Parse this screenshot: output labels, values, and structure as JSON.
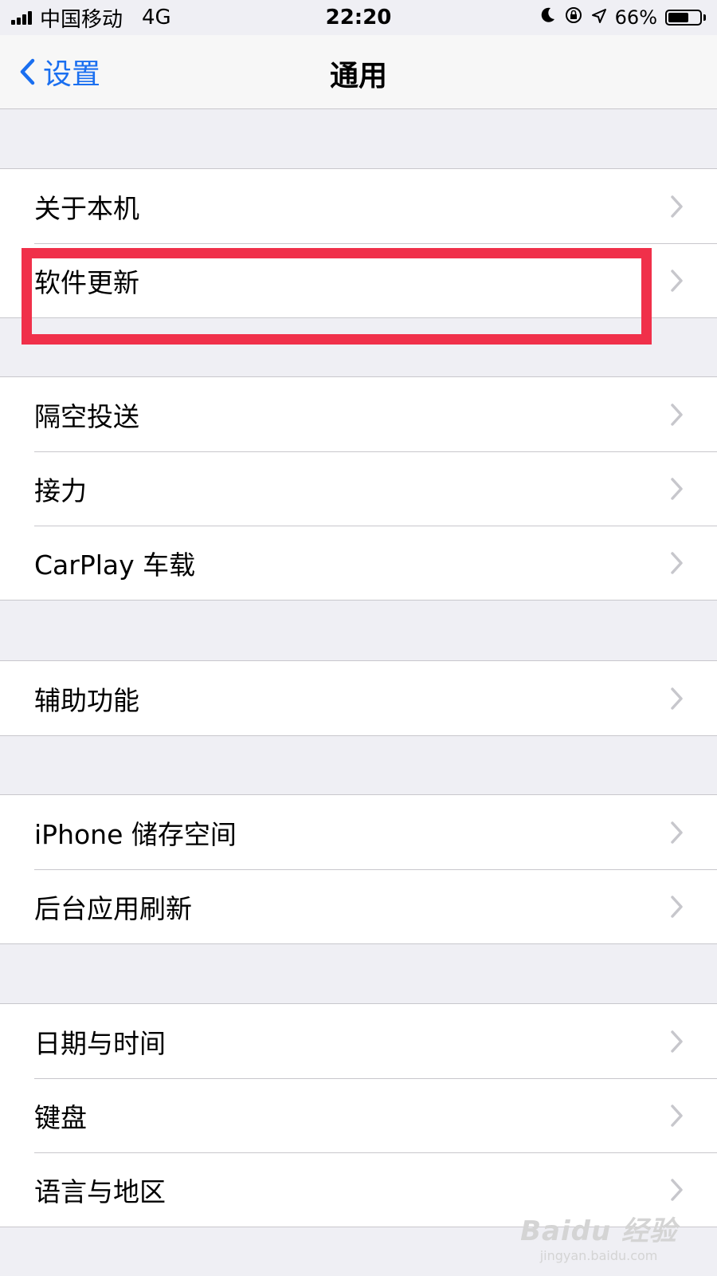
{
  "status_bar": {
    "carrier": "中国移动",
    "network": "4G",
    "time": "22:20",
    "battery_percent_text": "66%",
    "battery_level": 0.66,
    "icons": [
      "signal-icon",
      "moon-icon",
      "rotation-lock-icon",
      "location-icon",
      "battery-icon"
    ]
  },
  "nav": {
    "back_label": "设置",
    "title": "通用"
  },
  "groups": [
    {
      "items": [
        "关于本机",
        "软件更新"
      ]
    },
    {
      "items": [
        "隔空投送",
        "接力",
        "CarPlay 车载"
      ]
    },
    {
      "items": [
        "辅助功能"
      ]
    },
    {
      "items": [
        "iPhone 储存空间",
        "后台应用刷新"
      ]
    },
    {
      "items": [
        "日期与时间",
        "键盘",
        "语言与地区"
      ]
    }
  ],
  "annotation": {
    "highlight_color": "#f0304a",
    "highlighted_item": "软件更新"
  },
  "watermark": {
    "logo": "Baidu 经验",
    "url": "jingyan.baidu.com"
  },
  "colors": {
    "accent": "#1a6ff0",
    "background": "#efeff4",
    "separator": "#c8c7cc",
    "chevron": "#c7c7cc"
  }
}
